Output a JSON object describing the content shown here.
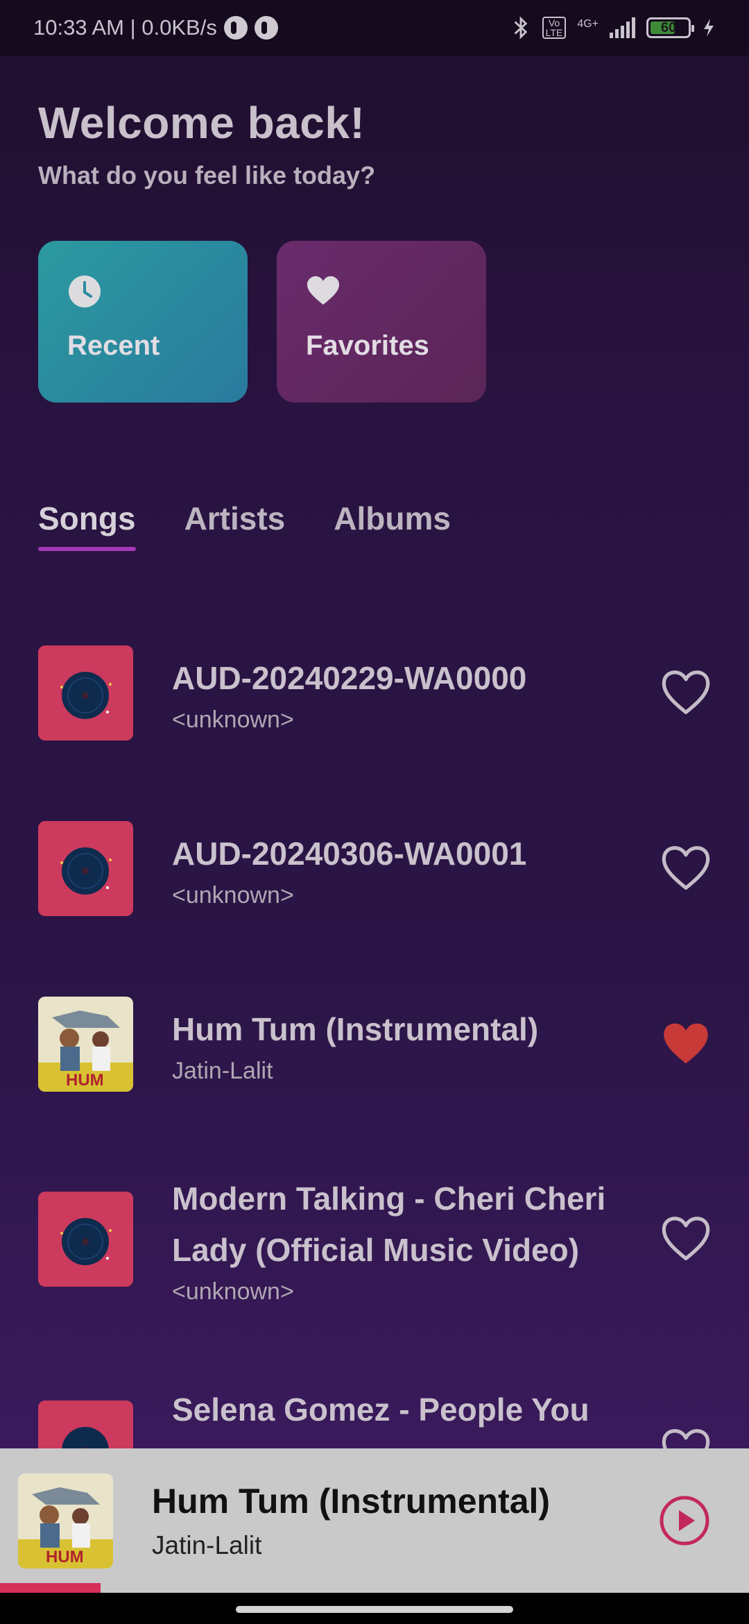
{
  "status_bar": {
    "time_speed": "10:33 AM | 0.0KB/s",
    "network": "4G+",
    "volte": "Vo\nLTE",
    "battery": "60"
  },
  "header": {
    "title": "Welcome back!",
    "subtitle": "What do you feel like today?"
  },
  "tiles": {
    "recent_label": "Recent",
    "favorites_label": "Favorites"
  },
  "tabs": [
    {
      "label": "Songs",
      "active": true
    },
    {
      "label": "Artists",
      "active": false
    },
    {
      "label": "Albums",
      "active": false
    }
  ],
  "songs": [
    {
      "title": "AUD-20240229-WA0000",
      "artist": "<unknown>",
      "favorite": false,
      "art": "generic-disc"
    },
    {
      "title": "AUD-20240306-WA0001",
      "artist": "<unknown>",
      "favorite": false,
      "art": "generic-disc"
    },
    {
      "title": "Hum Tum (Instrumental)",
      "artist": "Jatin-Lalit",
      "favorite": true,
      "art": "hum-tum-poster"
    },
    {
      "title": "Modern Talking - Cheri Cheri Lady (Official Music Video)",
      "artist": "<unknown>",
      "favorite": false,
      "art": "generic-disc"
    },
    {
      "title": "Selena Gomez - People You Know (Lyrics)",
      "artist": "",
      "favorite": false,
      "art": "generic-disc"
    }
  ],
  "now_playing": {
    "title": "Hum Tum (Instrumental)",
    "artist": "Jatin-Lalit",
    "progress": 0.13,
    "art": "hum-tum-poster"
  },
  "colors": {
    "accent": "#a537b6",
    "heart_active": "#c83a38",
    "play": "#c3285a",
    "tile_recent": "#2b9a9f",
    "tile_favorites": "#6a2b6c"
  }
}
